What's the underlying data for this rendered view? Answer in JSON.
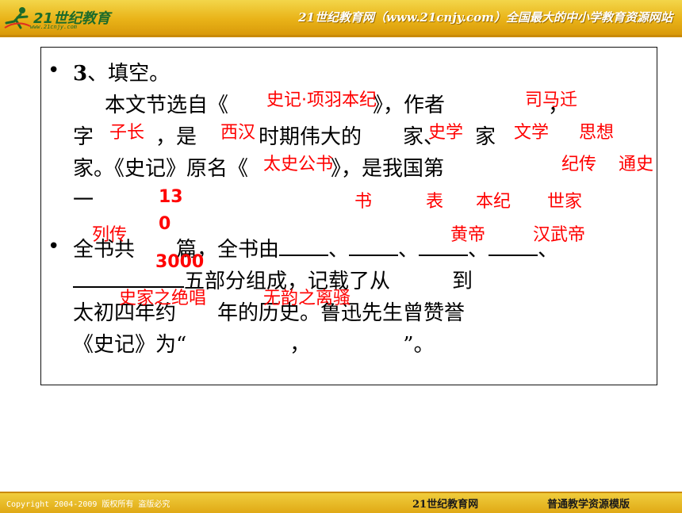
{
  "header": {
    "logo": "21世纪教育",
    "logo_url": "www.21cnjy.com",
    "slogan": "21世纪教育网（www.21cnjy.com）全国最大的中小学教育资源网站"
  },
  "question": {
    "number": "3",
    "title_rest": "、填空。",
    "line2": "本文节选自《　　　　　　　》，作者　　　　　，",
    "line3": "字　　　，是　　　时期伟大的　　家、　　家",
    "line4": "家。《史记》原名《　　　　》，是我国第",
    "line5": "一",
    "line6a": "全书共　　篇，全书由",
    "sep": "、",
    "line7b": "五部分组成，记载了从　　　到",
    "line8": "太初四年约　　年的历史。鲁迅先生曾赞誉",
    "line9": "《史记》为“　　　　　，　　　　　”。"
  },
  "answers": {
    "source": "史记·项羽本纪",
    "author": "司马迁",
    "courtesy_name": "子长",
    "dynasty": "西汉",
    "role1": "史学",
    "role2": "文学",
    "role3": "思想",
    "original_title": "太史公书",
    "genre1": "纪传",
    "genre2": "通史",
    "count_a": "13",
    "count_b": "0",
    "part1": "书",
    "part2": "表",
    "part3": "本纪",
    "part4": "世家",
    "part5": "列传",
    "from": "黄帝",
    "to": "汉武帝",
    "years": "3000",
    "praise1": "史家之绝唱",
    "praise2": "无韵之离骚"
  },
  "footer": {
    "copyright": "Copyright 2004-2009 版权所有 盗版必究",
    "brand": "21世纪教育网",
    "template": "普通教学资源模版"
  },
  "colors": {
    "answer": "#ff0000",
    "header": "#e9b318",
    "logo": "#1d6b2a"
  }
}
